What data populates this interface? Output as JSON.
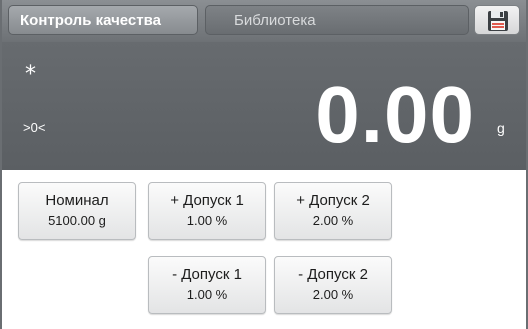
{
  "header": {
    "active_tab": "Контроль качества",
    "inactive_tab": "Библиотека",
    "save_icon": "floppy-disk-icon"
  },
  "display": {
    "stable_indicator": "*",
    "zero_indicator": ">0<",
    "weight": "0.00",
    "unit": "g"
  },
  "params": {
    "nominal": {
      "label": "Номинал",
      "value": "5100.00 g"
    },
    "plus_tol_1": {
      "label": "+ Допуск 1",
      "value": "1.00 %"
    },
    "plus_tol_2": {
      "label": "+ Допуск 2",
      "value": "2.00 %"
    },
    "minus_tol_1": {
      "label": "- Допуск 1",
      "value": "1.00 %"
    },
    "minus_tol_2": {
      "label": "- Допуск 2",
      "value": "2.00 %"
    }
  },
  "colors": {
    "header_bg": "#7a7e82",
    "display_bg": "#62666a",
    "button_bg": "#eeeeee",
    "save_accent": "#e05a4f"
  }
}
